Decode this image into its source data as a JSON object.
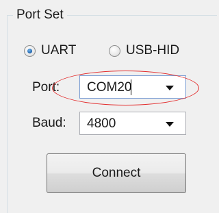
{
  "group": {
    "title": "Port Set"
  },
  "mode": {
    "options": [
      {
        "label": "UART",
        "selected": true
      },
      {
        "label": "USB-HID",
        "selected": false
      }
    ]
  },
  "port": {
    "label": "Port:",
    "value": "COM20",
    "icon": "chevron-down-icon"
  },
  "baud": {
    "label": "Baud:",
    "value": "4800",
    "icon": "chevron-down-icon"
  },
  "connect": {
    "label": "Connect"
  },
  "annotation": {
    "highlight_color": "#e32d2d"
  }
}
